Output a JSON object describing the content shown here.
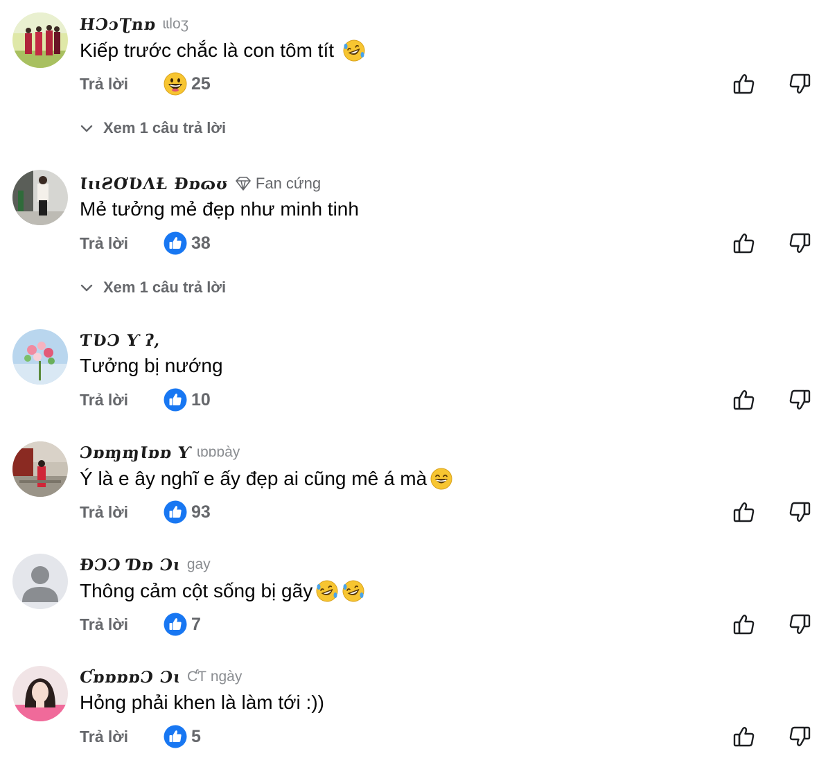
{
  "comments": [
    {
      "author": "HƆɔƮnɒ",
      "meta": "ɩɩloʒ",
      "badge": "",
      "text": "Kiếp trước chắc là con tôm tít",
      "text_emoji": "rolling-laughing-emoji",
      "reply_label": "Trả lời",
      "reaction_icon": "grinning-face-emoji",
      "reaction_count": "25",
      "view_replies": "Xem 1 câu trả lời"
    },
    {
      "author": "ƖɩɩƧƠƲɅȽ Ɖɒɷʊ",
      "meta": "",
      "badge": "Fan cứng",
      "text": "Mẻ tưởng mẻ đẹp như minh tinh",
      "text_emoji": "",
      "reply_label": "Trả lời",
      "reaction_icon": "like-icon",
      "reaction_count": "38",
      "view_replies": "Xem 1 câu trả lời"
    },
    {
      "author": "ƬƲƆ Ƴ ʔ,",
      "meta": "",
      "badge": "",
      "text": "Tưởng bị nướng",
      "text_emoji": "",
      "reply_label": "Trả lời",
      "reaction_icon": "like-icon",
      "reaction_count": "10",
      "view_replies": ""
    },
    {
      "author": "ƆɒɱɱƖɒɒ Ƴ",
      "meta": "ɩɒɒɒày",
      "badge": "",
      "text": "Ý là e ây nghĩ e ấy đẹp ai cũng mê á mà",
      "text_emoji": "smiling-face-emoji",
      "reply_label": "Trả lời",
      "reaction_icon": "like-icon",
      "reaction_count": "93",
      "view_replies": ""
    },
    {
      "author": "ƉƆƆ Ɗɒ Ɔɩ",
      "meta": "gay",
      "badge": "",
      "text": "Thông cảm cột sống bị gãy",
      "text_emoji": "rolling-laughing-emoji",
      "text_emoji2": "rolling-laughing-emoji",
      "reply_label": "Trả lời",
      "reaction_icon": "like-icon",
      "reaction_count": "7",
      "view_replies": ""
    },
    {
      "author": "ƇɒɒɒɒƆ Ɔɩ",
      "meta": "ƇƬ ngày",
      "badge": "",
      "text": "Hỏng phải khen là làm tới :))",
      "text_emoji": "",
      "reply_label": "Trả lời",
      "reaction_icon": "like-icon",
      "reaction_count": "5",
      "view_replies": ""
    }
  ],
  "colors": {
    "secondary_text": "#65676b",
    "like_blue": "#1877f2",
    "primary_text": "#050505"
  },
  "icons": {
    "upvote": "thumbs-up-outline-icon",
    "downvote": "thumbs-down-outline-icon",
    "expand": "chevron-down-icon",
    "fan_badge": "diamond-icon"
  }
}
